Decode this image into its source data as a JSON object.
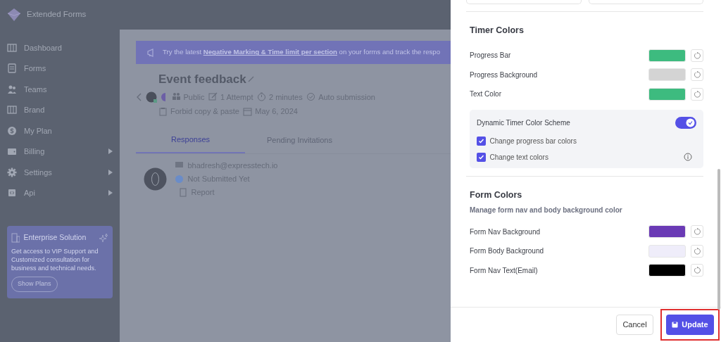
{
  "app": {
    "name": "Extended Forms"
  },
  "sidebar": {
    "items": [
      {
        "label": "Dashboard",
        "expandable": false
      },
      {
        "label": "Forms",
        "expandable": false
      },
      {
        "label": "Teams",
        "expandable": false
      },
      {
        "label": "Brand",
        "expandable": false
      },
      {
        "label": "My Plan",
        "expandable": false
      },
      {
        "label": "Billing",
        "expandable": true
      },
      {
        "label": "Settings",
        "expandable": true
      },
      {
        "label": "Api",
        "expandable": true
      }
    ],
    "promo": {
      "title": "Enterprise Solution",
      "text": "Get access to VIP Support and Customized consultation for business and technical needs.",
      "button": "Show Plans"
    }
  },
  "banner": {
    "text": "Try the latest **Negative Marking & Time limit per section** on your forms and track the respo"
  },
  "form": {
    "title": "Event feedback",
    "meta": [
      {
        "kind": "visibility",
        "label": "Public"
      },
      {
        "kind": "attempts",
        "label": "1 Attempt"
      },
      {
        "kind": "timer",
        "label": "2 minutes"
      },
      {
        "kind": "auto",
        "label": "Auto submission"
      },
      {
        "kind": "copy",
        "label": "Forbid copy & paste"
      },
      {
        "kind": "date",
        "label": "May 6, 2024"
      }
    ],
    "tabs": [
      {
        "label": "Responses",
        "selected": true
      },
      {
        "label": "Pending Invitations",
        "selected": false
      }
    ],
    "response": {
      "email": "bhadresh@expresstech.io",
      "status": "Not Submitted Yet",
      "link": "Report"
    }
  },
  "drawer": {
    "sections": [
      {
        "title": "Timer Colors",
        "colors": [
          {
            "label": "Progress Bar",
            "color": "#3dbb7f"
          },
          {
            "label": "Progress Background",
            "color": "#d4d4d4"
          },
          {
            "label": "Text Color",
            "color": "#3dbb7f"
          }
        ],
        "scheme": {
          "label": "Dynamic Timer Color Scheme",
          "on": true,
          "options": [
            {
              "label": "Change progress bar colors",
              "checked": true,
              "info": false
            },
            {
              "label": "Change text colors",
              "checked": true,
              "info": true
            }
          ]
        }
      },
      {
        "title": "Form Colors",
        "subtitle": "Manage form nav and body background color",
        "colors": [
          {
            "label": "Form Nav Background",
            "color": "#6a3ab5"
          },
          {
            "label": "Form Body Background",
            "color": "#efedfa"
          },
          {
            "label": "Form Nav Text(Email)",
            "color": "#000000"
          }
        ]
      }
    ],
    "buttons": [
      {
        "label": "Cancel",
        "kind": "secondary",
        "highlighted": false
      },
      {
        "label": "Update",
        "kind": "primary",
        "highlighted": true
      }
    ]
  }
}
